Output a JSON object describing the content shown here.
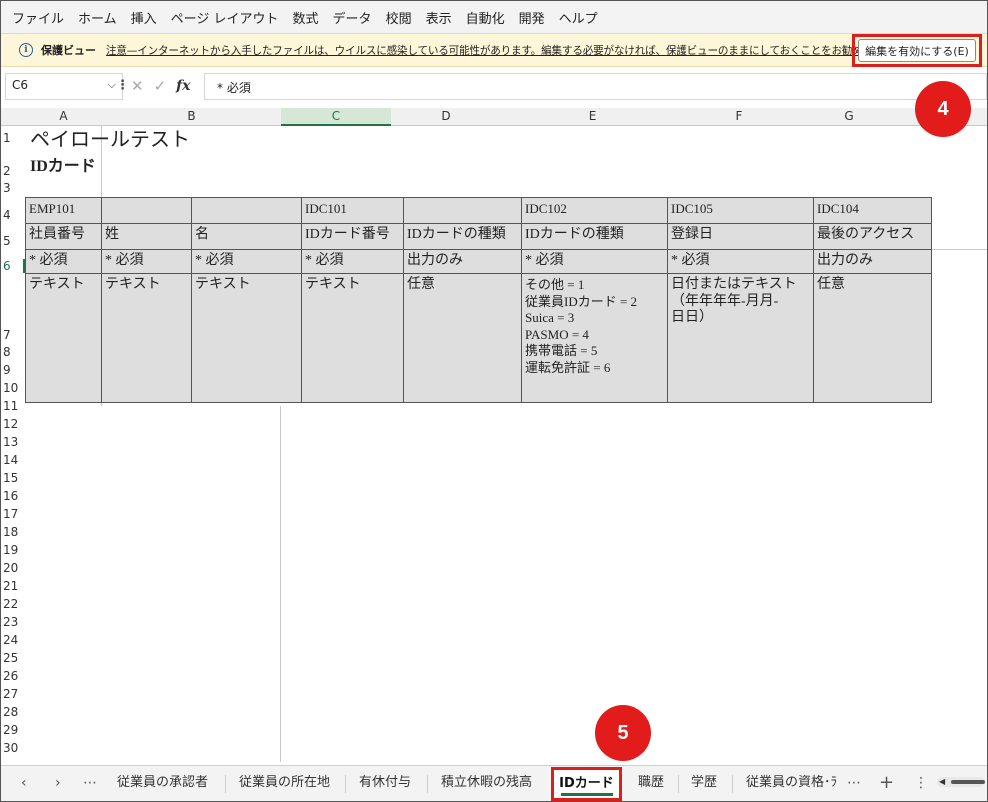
{
  "menu": [
    "ファイル",
    "ホーム",
    "挿入",
    "ページ レイアウト",
    "数式",
    "データ",
    "校閲",
    "表示",
    "自動化",
    "開発",
    "ヘルプ"
  ],
  "protected_view": {
    "icon": "info-icon",
    "title": "保護ビュー",
    "message": "注意—インターネットから入手したファイルは、ウイルスに感染している可能性があります。編集する必要がなければ、保護ビューのままにしておくことをお勧めします。",
    "enable_button": "編集を有効にする(E)"
  },
  "formula_bar": {
    "name_box": "C6",
    "dropdown": "⌵",
    "dots": "⋮",
    "cancel": "✕",
    "enter": "✓",
    "fx": "fx",
    "content": "* 必須"
  },
  "columns": [
    "A",
    "B",
    "C",
    "D",
    "E",
    "F",
    "G"
  ],
  "selected_column": "C",
  "rows": [
    "1",
    "2",
    "3",
    "4",
    "5",
    "6",
    "7",
    "8",
    "9",
    "10",
    "11",
    "12",
    "13",
    "14",
    "15",
    "16",
    "17",
    "18",
    "19",
    "20",
    "21",
    "22",
    "23",
    "24",
    "25",
    "26",
    "27",
    "28",
    "29",
    "30"
  ],
  "selected_row": "6",
  "sheet": {
    "title": "ペイロールテスト",
    "subtitle": "IDカード",
    "table": [
      [
        "EMP101",
        "",
        "",
        "IDC101",
        "",
        "IDC102",
        "IDC105",
        "IDC104"
      ],
      [
        "社員番号",
        "姓",
        "名",
        "IDカード番号",
        "IDカードの種類",
        "IDカードの種類",
        "登録日",
        "最後のアクセス"
      ],
      [
        "* 必須",
        "* 必須",
        "* 必須",
        "* 必須",
        "出力のみ",
        "* 必須",
        "* 必須",
        "出力のみ"
      ],
      [
        "テキスト",
        "テキスト",
        "テキスト",
        "テキスト",
        "任意",
        "その他 = 1\n従業員IDカード = 2\nSuica = 3\nPASMO = 4\n携帯電話 = 5\n運転免許証 = 6",
        "日付またはテキスト\n（年年年年-月月-\n日日）",
        "任意"
      ]
    ]
  },
  "tabs": {
    "nav_prev": "‹",
    "nav_next": "›",
    "nav_more": "⋯",
    "items": [
      "従業員の承認者",
      "従業員の所在地",
      "有休付与",
      "積立休暇の残高",
      "IDカード",
      "職歴",
      "学歴",
      "従業員の資格･ﾗ"
    ],
    "active": "IDカード",
    "more": "⋯",
    "add": "+",
    "options": "⋮"
  },
  "callouts": [
    "4",
    "5"
  ],
  "colors": {
    "callout": "#e21b1b",
    "active_accent": "#217346",
    "protected_bg": "#fdf6d8"
  }
}
